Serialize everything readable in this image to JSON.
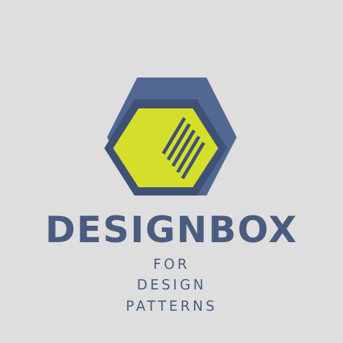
{
  "brand": {
    "name": "DESIGNBOX",
    "tagline_lines": [
      "FOR",
      "DESIGN",
      "PATTERNS"
    ]
  },
  "colors": {
    "background": "#dedede",
    "navy": "#4a5d80",
    "navy_dark": "#3c4d6e",
    "lime": "#d6df2b"
  },
  "icon": {
    "name": "hexagon-logo-icon"
  }
}
